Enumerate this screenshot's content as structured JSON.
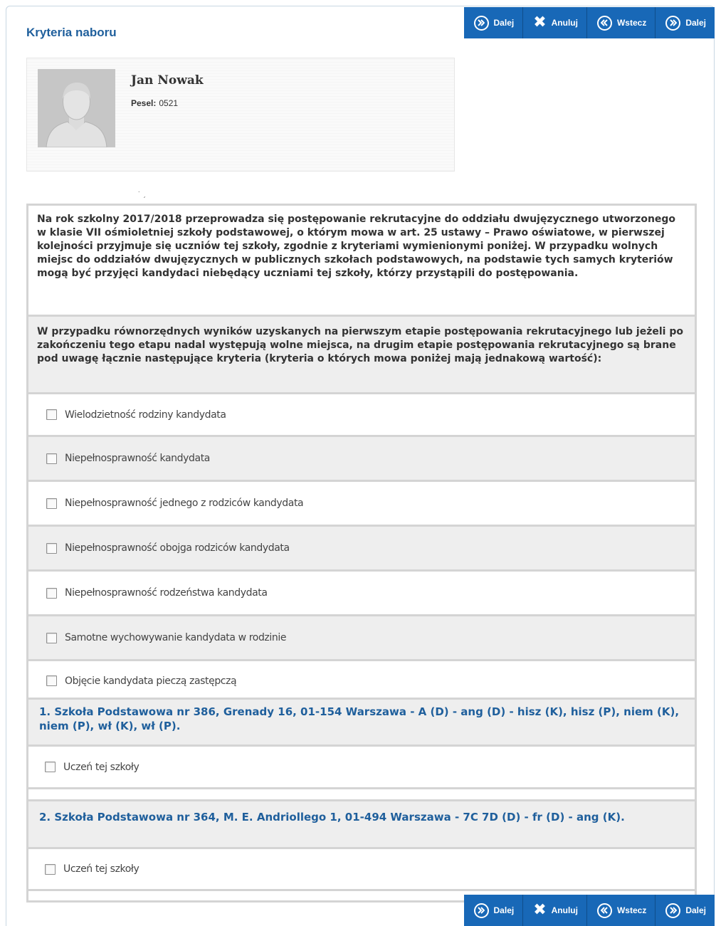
{
  "toolbar": {
    "buttons": [
      {
        "label": "Dalej",
        "icon": "next-circle-icon"
      },
      {
        "label": "Anuluj",
        "icon": "close-icon"
      },
      {
        "label": "Wstecz",
        "icon": "back-circle-icon"
      },
      {
        "label": "Dalej",
        "icon": "next-circle-icon"
      }
    ]
  },
  "page_title": "Kryteria naboru",
  "profile": {
    "name": "Jan Nowak",
    "pesel_label": "Pesel:",
    "pesel_value": "0521"
  },
  "intro": {
    "paragraph1": "Na rok szkolny 2017/2018 przeprowadza się postępowanie rekrutacyjne do oddziału dwujęzycznego utworzonego w klasie VII ośmioletniej szkoły podstawowej, o którym mowa w art. 25 ustawy – Prawo oświatowe, w pierwszej kolejności przyjmuje się uczniów tej szkoły, zgodnie z kryteriami wymienionymi poniżej. W przypadku wolnych miejsc do oddziałów dwujęzycznych w publicznych szkołach podstawowych, na podstawie tych samych kryteriów mogą być przyjęci kandydaci niebędący uczniami tej szkoły, którzy przystąpili do postępowania.",
    "paragraph2": "W przypadku równorzędnych wyników uzyskanych na pierwszym etapie postępowania rekrutacyjnego lub jeżeli po zakończeniu tego etapu nadal występują wolne miejsca, na drugim etapie postępowania rekrutacyjnego są brane pod uwagę łącznie następujące kryteria (kryteria o których mowa poniżej mają jednakową wartość):"
  },
  "criteria": [
    {
      "label": "Wielodzietność rodziny kandydata",
      "checked": false
    },
    {
      "label": "Niepełnosprawność kandydata",
      "checked": false
    },
    {
      "label": "Niepełnosprawność jednego z rodziców kandydata",
      "checked": false
    },
    {
      "label": "Niepełnosprawność obojga rodziców kandydata",
      "checked": false
    },
    {
      "label": "Niepełnosprawność rodzeństwa kandydata",
      "checked": false
    },
    {
      "label": "Samotne wychowywanie kandydata w rodzinie",
      "checked": false
    },
    {
      "label": "Objęcie kandydata pieczą zastępczą",
      "checked": false
    }
  ],
  "schools": [
    {
      "title": "1. Szkoła Podstawowa nr 386, Grenady 16, 01-154 Warszawa - A (D) - ang (D) - hisz (K), hisz (P), niem (K), niem (P), wł (K), wł (P).",
      "criterion": {
        "label": "Uczeń tej szkoły",
        "checked": false
      }
    },
    {
      "title": "2. Szkoła Podstawowa nr 364, M. E. Andriollego 1, 01-494 Warszawa - 7C 7D (D) - fr (D) - ang (K).",
      "criterion": {
        "label": "Uczeń tej szkoły",
        "checked": false
      }
    }
  ],
  "colors": {
    "toolbar_bg": "#1868b7",
    "title_blue": "#1f5f9c",
    "row_gray": "#eeeeee",
    "border_gray": "#d4d4d4"
  }
}
